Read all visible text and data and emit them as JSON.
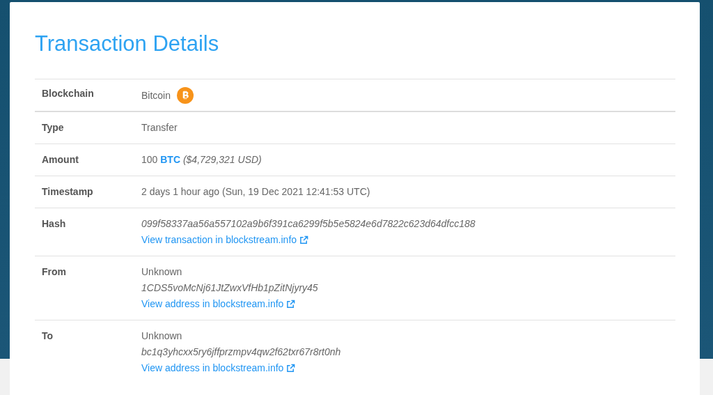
{
  "title": "Transaction Details",
  "rows": [
    {
      "label": "Blockchain",
      "lines": [
        {
          "kind": "coin",
          "text": "Bitcoin"
        }
      ]
    },
    {
      "label": "Type",
      "lines": [
        {
          "kind": "plain",
          "text": "Transfer"
        }
      ]
    },
    {
      "label": "Amount",
      "lines": [
        {
          "kind": "amount",
          "value": "100",
          "unit": "BTC",
          "fiat": "($4,729,321 USD)"
        }
      ]
    },
    {
      "label": "Timestamp",
      "lines": [
        {
          "kind": "plain",
          "text": "2 days 1 hour ago (Sun, 19 Dec 2021 12:41:53 UTC)"
        }
      ]
    },
    {
      "label": "Hash",
      "lines": [
        {
          "kind": "mono",
          "text": "099f58337aa56a557102a9b6f391ca6299f5b5e5824e6d7822c623d64dfcc188"
        },
        {
          "kind": "link",
          "text": "View transaction in blockstream.info"
        }
      ]
    },
    {
      "label": "From",
      "lines": [
        {
          "kind": "plain",
          "text": "Unknown"
        },
        {
          "kind": "mono",
          "text": "1CDS5voMcNj61JtZwxVfHb1pZitNjyry45"
        },
        {
          "kind": "link",
          "text": "View address in blockstream.info"
        }
      ]
    },
    {
      "label": "To",
      "lines": [
        {
          "kind": "plain",
          "text": "Unknown"
        },
        {
          "kind": "mono",
          "text": "bc1q3yhcxx5ry6jffprzmpv4qw2f62txr67r8rt0nh"
        },
        {
          "kind": "link",
          "text": "View address in blockstream.info"
        }
      ]
    }
  ]
}
